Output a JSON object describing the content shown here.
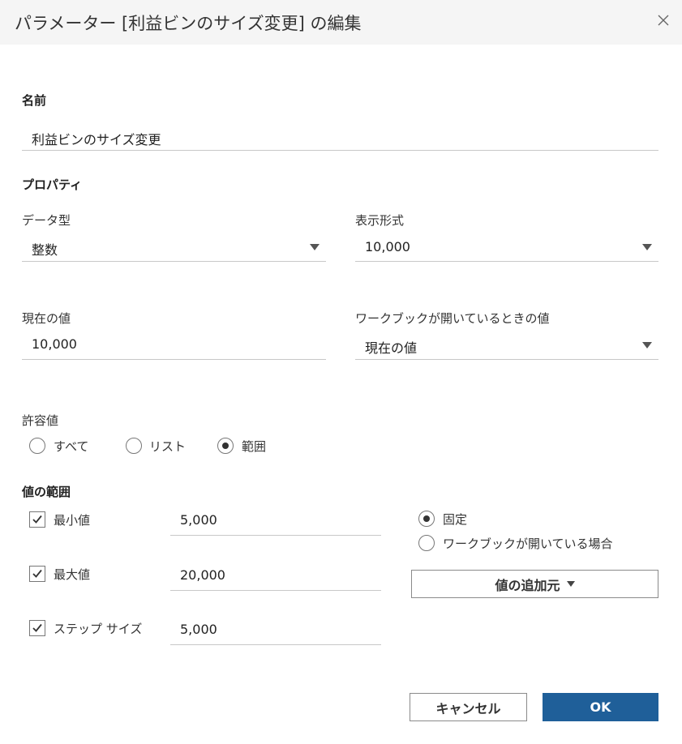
{
  "dialog": {
    "title": "パラメーター [利益ビンのサイズ変更] の編集"
  },
  "name_section": {
    "heading": "名前",
    "value": "利益ビンのサイズ変更"
  },
  "properties": {
    "heading": "プロパティ",
    "data_type_label": "データ型",
    "data_type_value": "整数",
    "display_format_label": "表示形式",
    "display_format_value": "10,000",
    "current_value_label": "現在の値",
    "current_value": "10,000",
    "workbook_open_label": "ワークブックが開いているときの値",
    "workbook_open_value": "現在の値"
  },
  "allowable": {
    "label": "許容値",
    "options": [
      "すべて",
      "リスト",
      "範囲"
    ],
    "selected": "範囲"
  },
  "range": {
    "heading": "値の範囲",
    "min_label": "最小値",
    "min_value": "5,000",
    "min_checked": true,
    "max_label": "最大値",
    "max_value": "20,000",
    "max_checked": true,
    "step_label": "ステップ サイズ",
    "step_value": "5,000",
    "step_checked": true,
    "fixed_label": "固定",
    "workbook_open_label": "ワークブックが開いている場合",
    "selected": "固定",
    "add_from_label": "値の追加元"
  },
  "footer": {
    "cancel_label": "キャンセル",
    "ok_label": "OK"
  },
  "colors": {
    "primary": "#1f5f99",
    "titlebar_bg": "#f5f5f5"
  }
}
